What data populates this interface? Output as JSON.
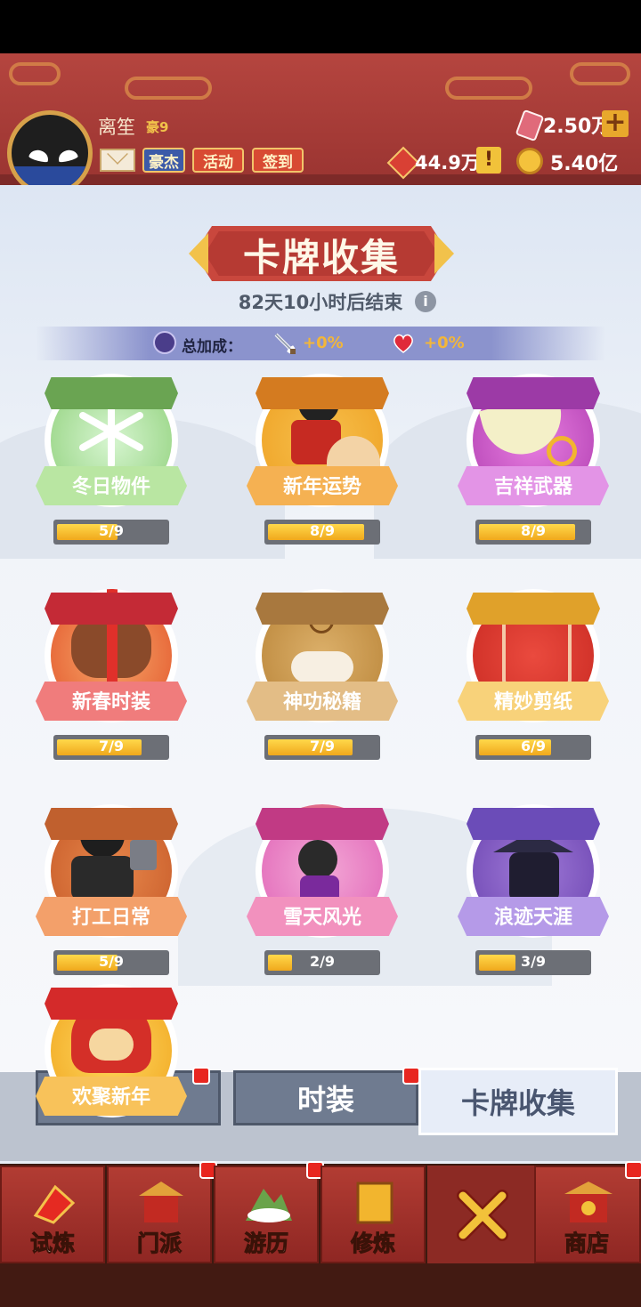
{
  "player": {
    "name": "离笙",
    "rank": "豪9",
    "buttons": {
      "hero": "豪杰",
      "event": "活动",
      "sign_in": "签到"
    }
  },
  "currency": {
    "gems": "2.50万",
    "gems_plus": "+",
    "honor": "44.9万",
    "honor_alert": "!",
    "coins": "5.40亿"
  },
  "page": {
    "title": "卡牌收集",
    "countdown": "82天10小时后结束",
    "info": "i"
  },
  "bonus": {
    "label": "总加成：",
    "attack": "+0%",
    "hp": "+0%"
  },
  "cards": [
    {
      "name": "冬日物件",
      "progress": "5/9",
      "fraction": 0.5556
    },
    {
      "name": "新年运势",
      "progress": "8/9",
      "fraction": 0.8889
    },
    {
      "name": "吉祥武器",
      "progress": "8/9",
      "fraction": 0.8889
    },
    {
      "name": "新春时装",
      "progress": "7/9",
      "fraction": 0.7778
    },
    {
      "name": "神功秘籍",
      "progress": "7/9",
      "fraction": 0.7778
    },
    {
      "name": "精妙剪纸",
      "progress": "6/9",
      "fraction": 0.6667
    },
    {
      "name": "打工日常",
      "progress": "5/9",
      "fraction": 0.5556
    },
    {
      "name": "雪天风光",
      "progress": "2/9",
      "fraction": 0.2222
    },
    {
      "name": "浪迹天涯",
      "progress": "3/9",
      "fraction": 0.3333
    },
    {
      "name": "欢聚新年"
    }
  ],
  "tabs": {
    "fashion": "时装",
    "cards": "卡牌收集"
  },
  "nav": {
    "trial": "试炼",
    "sect": "门派",
    "travel": "游历",
    "cultivate": "修炼",
    "shop": "商店"
  },
  "colors": {
    "header_red": "#b5453f",
    "gold": "#f2b63a",
    "nav_red": "#a8352e"
  },
  "icons": [
    "mail-icon",
    "gem-icon",
    "honor-icon",
    "coin-icon",
    "info-icon",
    "sword-icon",
    "heart-icon",
    "close-icon"
  ]
}
